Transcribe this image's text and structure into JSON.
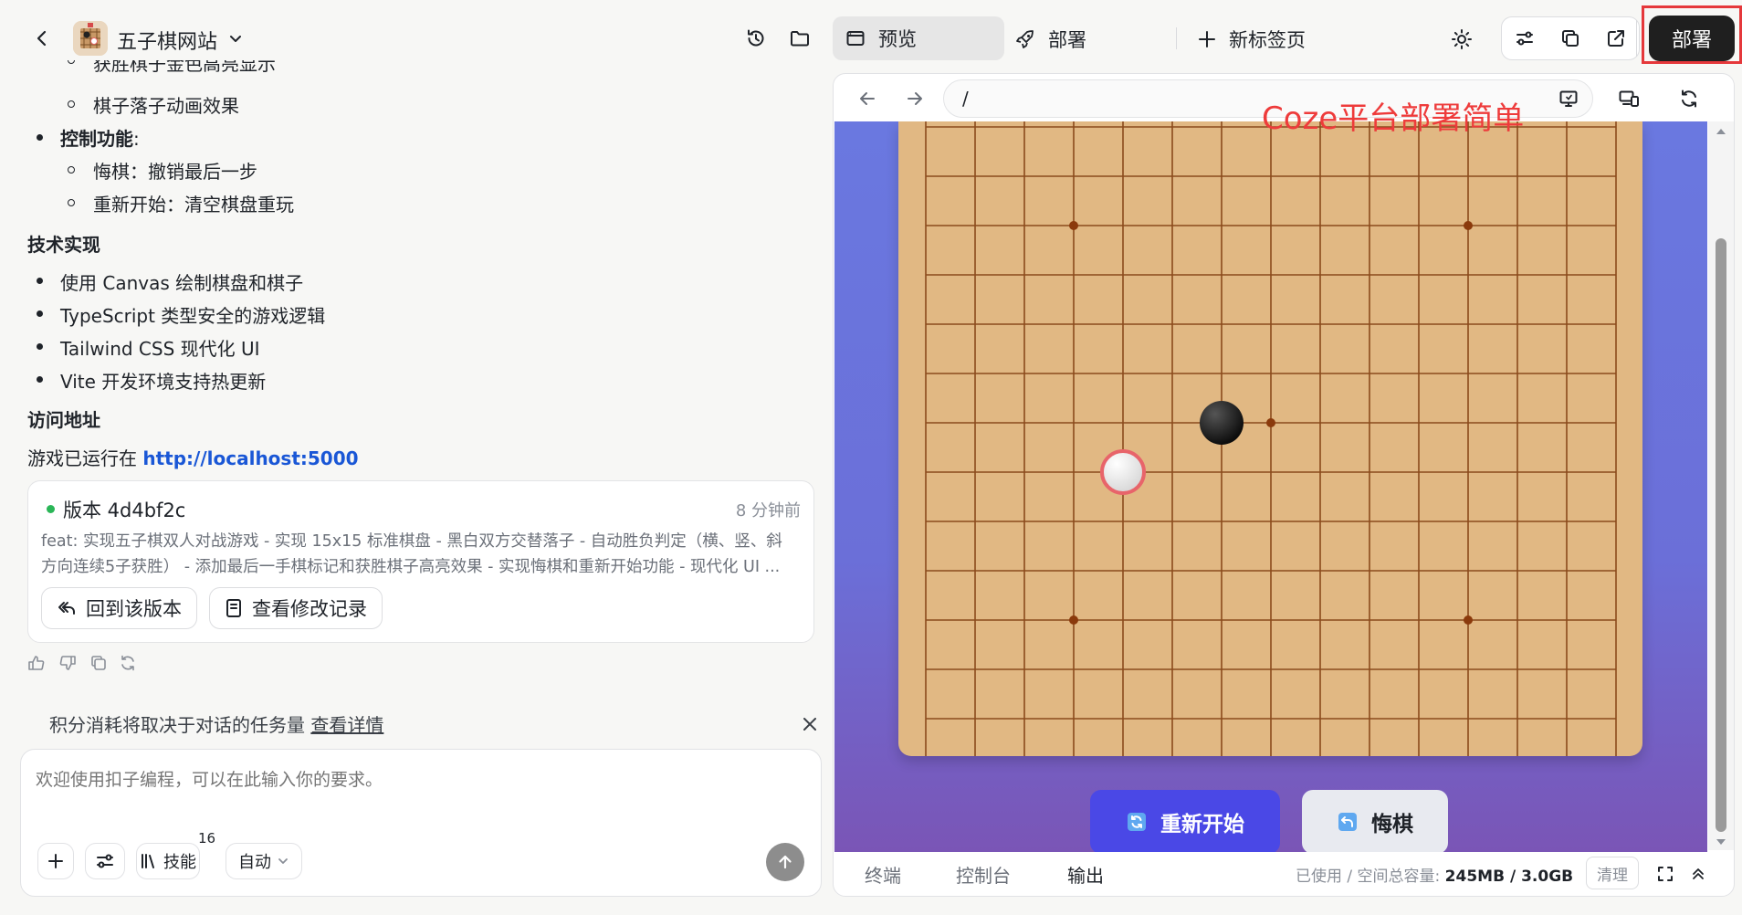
{
  "project": {
    "title": "五子棋网站"
  },
  "chat": {
    "cut_line": "获胜棋子金色高亮显示",
    "lines": {
      "anim": "棋子落子动画效果",
      "controls_title": "控制功能",
      "controls_colon": ":",
      "undo": "悔棋：撤销最后一步",
      "restart": "重新开始：清空棋盘重玩",
      "tech_title": "技术实现",
      "tech1": "使用 Canvas 绘制棋盘和棋子",
      "tech2": "TypeScript 类型安全的游戏逻辑",
      "tech3": "Tailwind CSS 现代化 UI",
      "tech4": "Vite 开发环境支持热更新",
      "access_title": "访问地址",
      "running_prefix": "游戏已运行在 ",
      "running_url": "http://localhost:5000"
    },
    "version_card": {
      "label": "版本 4d4bf2c",
      "time": "8 分钟前",
      "desc1": "feat: 实现五子棋双人对战游戏 - 实现 15x15 标准棋盘 - 黑白双方交替落子 - 自动胜负判定（横、竖、斜",
      "desc2": "方向连续5子获胜） - 添加最后一手棋标记和获胜棋子高亮效果 - 实现悔棋和重新开始功能 - 现代化 UI ...",
      "revert_label": "回到该版本",
      "history_label": "查看修改记录"
    },
    "notice": {
      "text": "积分消耗将取决于对话的任务量 ",
      "link": "查看详情"
    },
    "composer": {
      "placeholder": "欢迎使用扣子编程，可以在此输入你的要求。",
      "skills_label": "技能",
      "skills_count": "16",
      "mode_label": "自动"
    }
  },
  "right": {
    "tabs": {
      "preview": "预览",
      "deploy": "部署",
      "new_tab": "新标签页"
    },
    "deploy_button": "部署",
    "url": "/",
    "annotation": "Coze平台部署简单",
    "game": {
      "restart_label": "重新开始",
      "undo_label": "悔棋"
    },
    "bottom": {
      "tab_terminal": "终端",
      "tab_console": "控制台",
      "tab_output": "输出",
      "storage_prefix": "已使用 / 空间总容量: ",
      "storage_value": "245MB / 3.0GB",
      "clear_label": "清理"
    }
  },
  "colors": {
    "accent_blue": "#4a48e6",
    "deploy_highlight": "#e5383b",
    "board": "#e1b883",
    "link": "#1a57d6"
  },
  "icons": [
    "back-icon",
    "chevron-down-icon",
    "history-icon",
    "folder-icon",
    "window-icon",
    "rocket-icon",
    "plus-icon",
    "sun-icon",
    "sliders-icon",
    "copy-icon",
    "external-link-icon",
    "arrow-left-icon",
    "arrow-right-icon",
    "monitor-icon",
    "devices-icon",
    "refresh-icon",
    "thumbs-up-icon",
    "thumbs-down-icon",
    "close-icon",
    "send-icon",
    "fullscreen-icon",
    "chevron-up-icon"
  ]
}
